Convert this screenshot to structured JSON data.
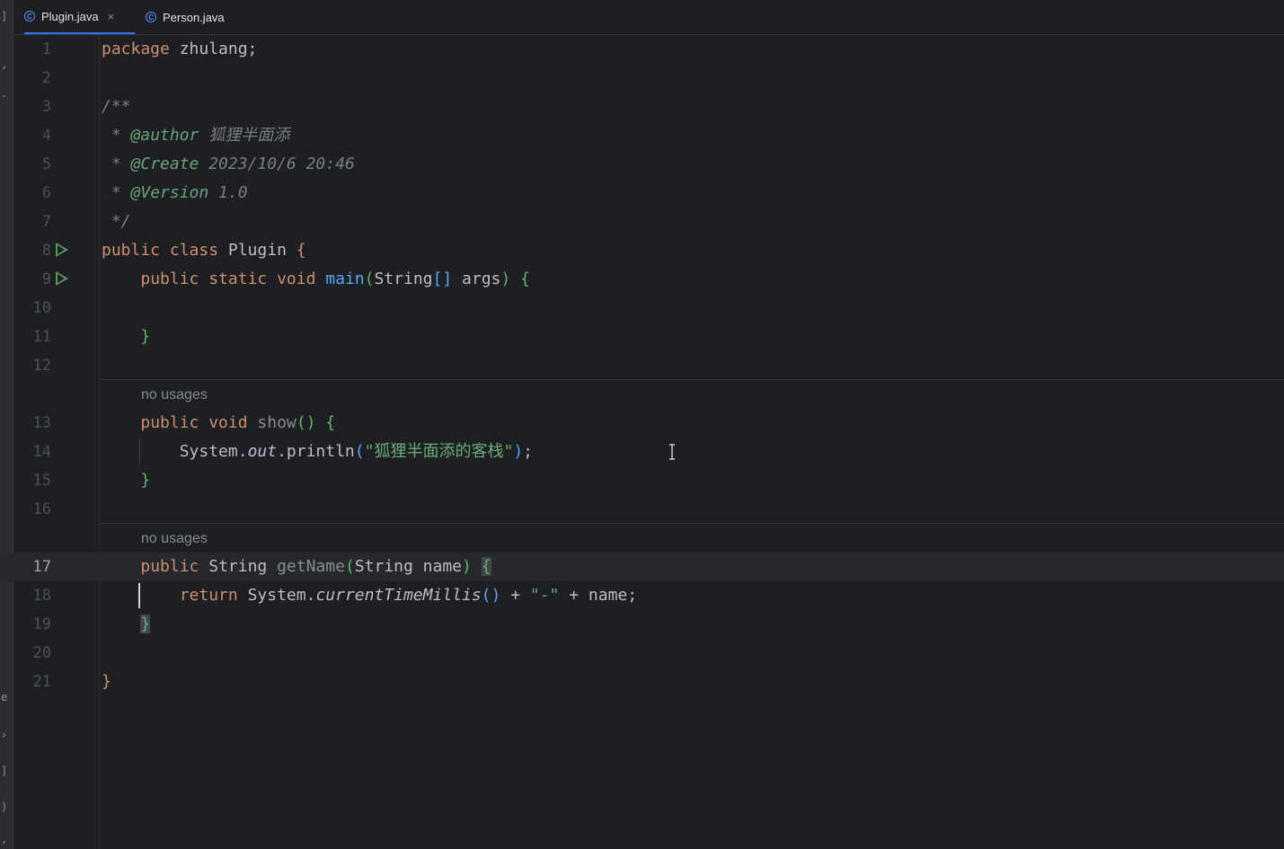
{
  "tabs": [
    {
      "label": "Plugin.java",
      "icon": "c-class-icon",
      "active": true,
      "close": "×"
    },
    {
      "label": "Person.java",
      "icon": "c-class-icon",
      "active": false
    }
  ],
  "hints": {
    "no_usages_1": "no usages",
    "no_usages_2": "no usages"
  },
  "line_numbers": [
    "1",
    "2",
    "3",
    "4",
    "5",
    "6",
    "7",
    "8",
    "9",
    "10",
    "11",
    "12",
    "13",
    "14",
    "15",
    "16",
    "17",
    "18",
    "19",
    "20",
    "21"
  ],
  "current_line": 17,
  "code": {
    "l1": {
      "kw": "package",
      "rest": " zhulang;"
    },
    "l3": {
      "comment": "/**"
    },
    "l4": {
      "prefix": " * ",
      "tag": "@author",
      "value": " 狐狸半面添"
    },
    "l5": {
      "prefix": " * ",
      "tag": "@Create",
      "value": " 2023/10/6 20:46"
    },
    "l6": {
      "prefix": " * ",
      "tag": "@Version",
      "value": " 1.0"
    },
    "l7": {
      "comment": " */"
    },
    "l8": {
      "kw": "public class",
      "name": " Plugin ",
      "brace": "{"
    },
    "l9": {
      "indent": "    ",
      "kw": "public static void",
      "fn": " main",
      "open": "(",
      "type": "String",
      "arr": "[]",
      "arg": " args",
      "close": ")",
      "brace": " {"
    },
    "l11": {
      "indent": "    ",
      "brace": "}"
    },
    "l13": {
      "indent": "    ",
      "kw": "public void",
      "fn": " show",
      "paren": "()",
      "brace": " {"
    },
    "l14": {
      "indent": "        ",
      "obj": "System.",
      "field": "out",
      "call": ".println",
      "open": "(",
      "str": "\"狐狸半面添的客栈\"",
      "close": ")",
      "end": ";"
    },
    "l15": {
      "indent": "    ",
      "brace": "}"
    },
    "l17": {
      "indent": "    ",
      "kw": "public",
      "type": " String",
      "fn": " getName",
      "open": "(",
      "ptype": "String",
      "pname": " name",
      "close": ")",
      "brace": "{"
    },
    "l18": {
      "indent": "        ",
      "kw": "return",
      "obj": " System.",
      "call": "currentTimeMillis",
      "paren": "()",
      "op": " + ",
      "str": "\"-\"",
      "rest": " + name;"
    },
    "l19": {
      "indent": "    ",
      "brace": "}"
    },
    "l21": {
      "brace": "}"
    }
  }
}
